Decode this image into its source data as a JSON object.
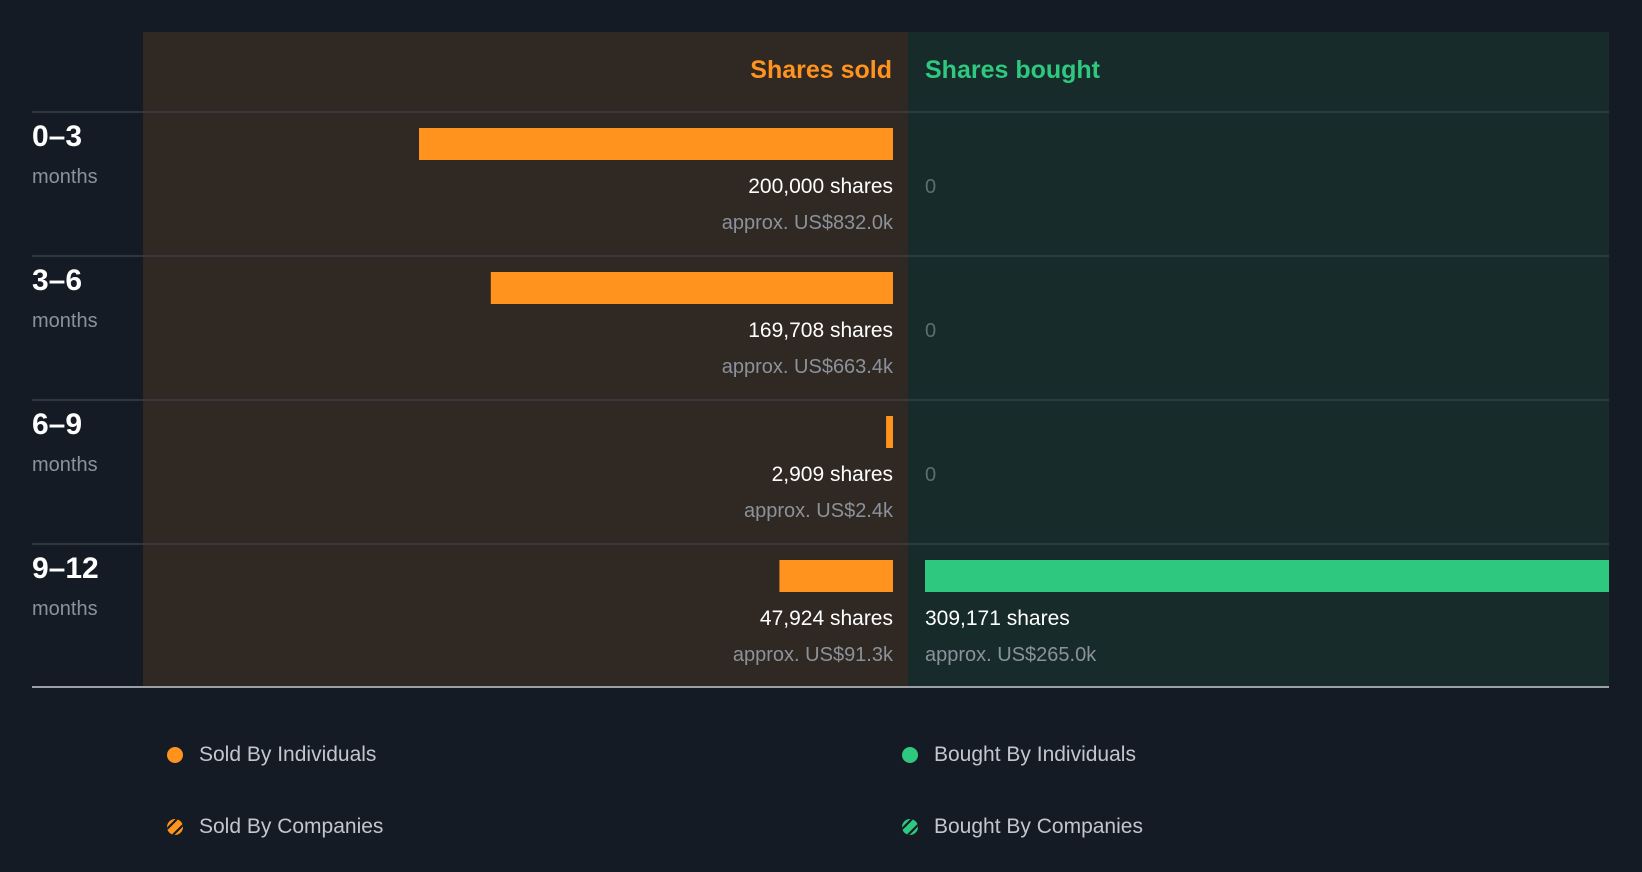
{
  "chart_data": {
    "type": "bar",
    "subtype": "diverging-horizontal",
    "headers": {
      "sold": "Shares sold",
      "bought": "Shares bought"
    },
    "categories": [
      {
        "range": "0–3",
        "unit": "months"
      },
      {
        "range": "3–6",
        "unit": "months"
      },
      {
        "range": "6–9",
        "unit": "months"
      },
      {
        "range": "9–12",
        "unit": "months"
      }
    ],
    "series": [
      {
        "name": "Shares sold",
        "side": "left",
        "values": [
          200000,
          169708,
          2909,
          47924
        ],
        "labels": [
          "200,000 shares",
          "169,708 shares",
          "2,909 shares",
          "47,924 shares"
        ],
        "value_labels": [
          "approx. US$832.0k",
          "approx. US$663.4k",
          "approx. US$2.4k",
          "approx. US$91.3k"
        ]
      },
      {
        "name": "Shares bought",
        "side": "right",
        "values": [
          0,
          0,
          0,
          309171
        ],
        "labels": [
          "0",
          "0",
          "0",
          "309,171 shares"
        ],
        "value_labels": [
          "",
          "",
          "",
          "approx. US$265.0k"
        ]
      }
    ],
    "xlim": [
      0,
      309171
    ],
    "legend": {
      "placement": "bottom",
      "items": [
        {
          "label": "Sold By Individuals",
          "color": "#ff931e",
          "style": "solid"
        },
        {
          "label": "Bought By Individuals",
          "color": "#2ec87f",
          "style": "solid"
        },
        {
          "label": "Sold By Companies",
          "color": "#ff931e",
          "style": "striped"
        },
        {
          "label": "Bought By Companies",
          "color": "#2ec87f",
          "style": "striped"
        }
      ]
    }
  },
  "colors": {
    "background": "#151b24",
    "sold_panel": "#302822",
    "bought_panel": "#172b2a",
    "sold_bar": "#ff931e",
    "bought_bar": "#2ec87f",
    "divider": "#3a4048",
    "axis": "#9aa0a6"
  }
}
